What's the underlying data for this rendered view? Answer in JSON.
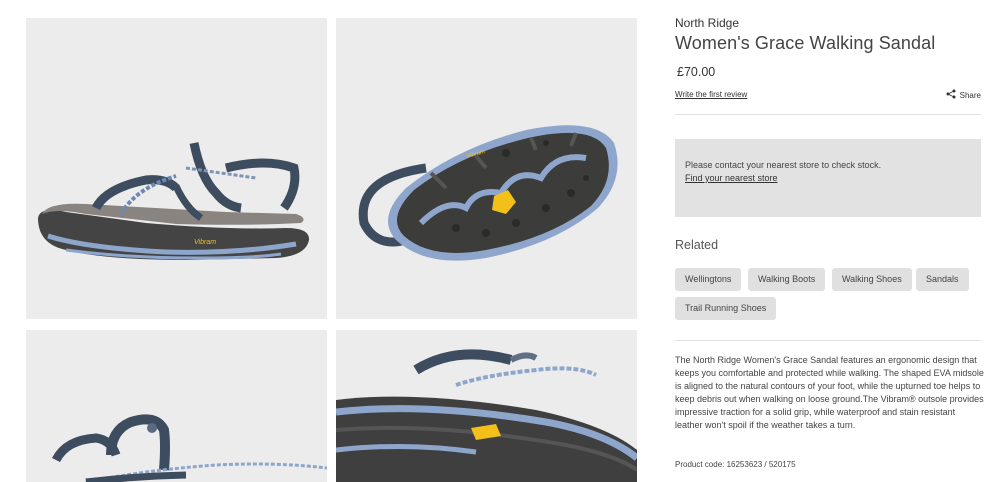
{
  "product": {
    "brand": "North Ridge",
    "title": "Women's Grace Walking Sandal",
    "price": "£70.00",
    "review_link": "Write the first review",
    "share_label": "Share",
    "product_code": "Product code: 16253623 / 520175"
  },
  "stock": {
    "message": "Please contact your nearest store to check stock.",
    "link": "Find your nearest store"
  },
  "related": {
    "heading": "Related",
    "tags": [
      "Wellingtons",
      "Walking Boots",
      "Walking Shoes",
      "Sandals",
      "Trail Running Shoes"
    ]
  },
  "description": "The North Ridge Women's Grace Sandal features an ergonomic design that keeps you comfortable and protected while walking. The shaped EVA midsole is aligned to the natural contours of your foot, while the upturned toe helps to keep debris out when walking on loose ground.The Vibram® outsole provides impressive traction for a solid grip, while waterproof and stain resistant leather won't spoil if the weather takes a turn.",
  "gallery": {
    "images": [
      "sandal-side-view",
      "sandal-sole-view",
      "sandal-heel-detail",
      "sandal-outsole-closeup"
    ]
  },
  "colors": {
    "image_bg": "#ececec",
    "strap": "#3e4c5f",
    "sole_dark": "#3f3f3f",
    "sole_accent": "#8fa6cc",
    "vibram_yellow": "#f2c019"
  }
}
